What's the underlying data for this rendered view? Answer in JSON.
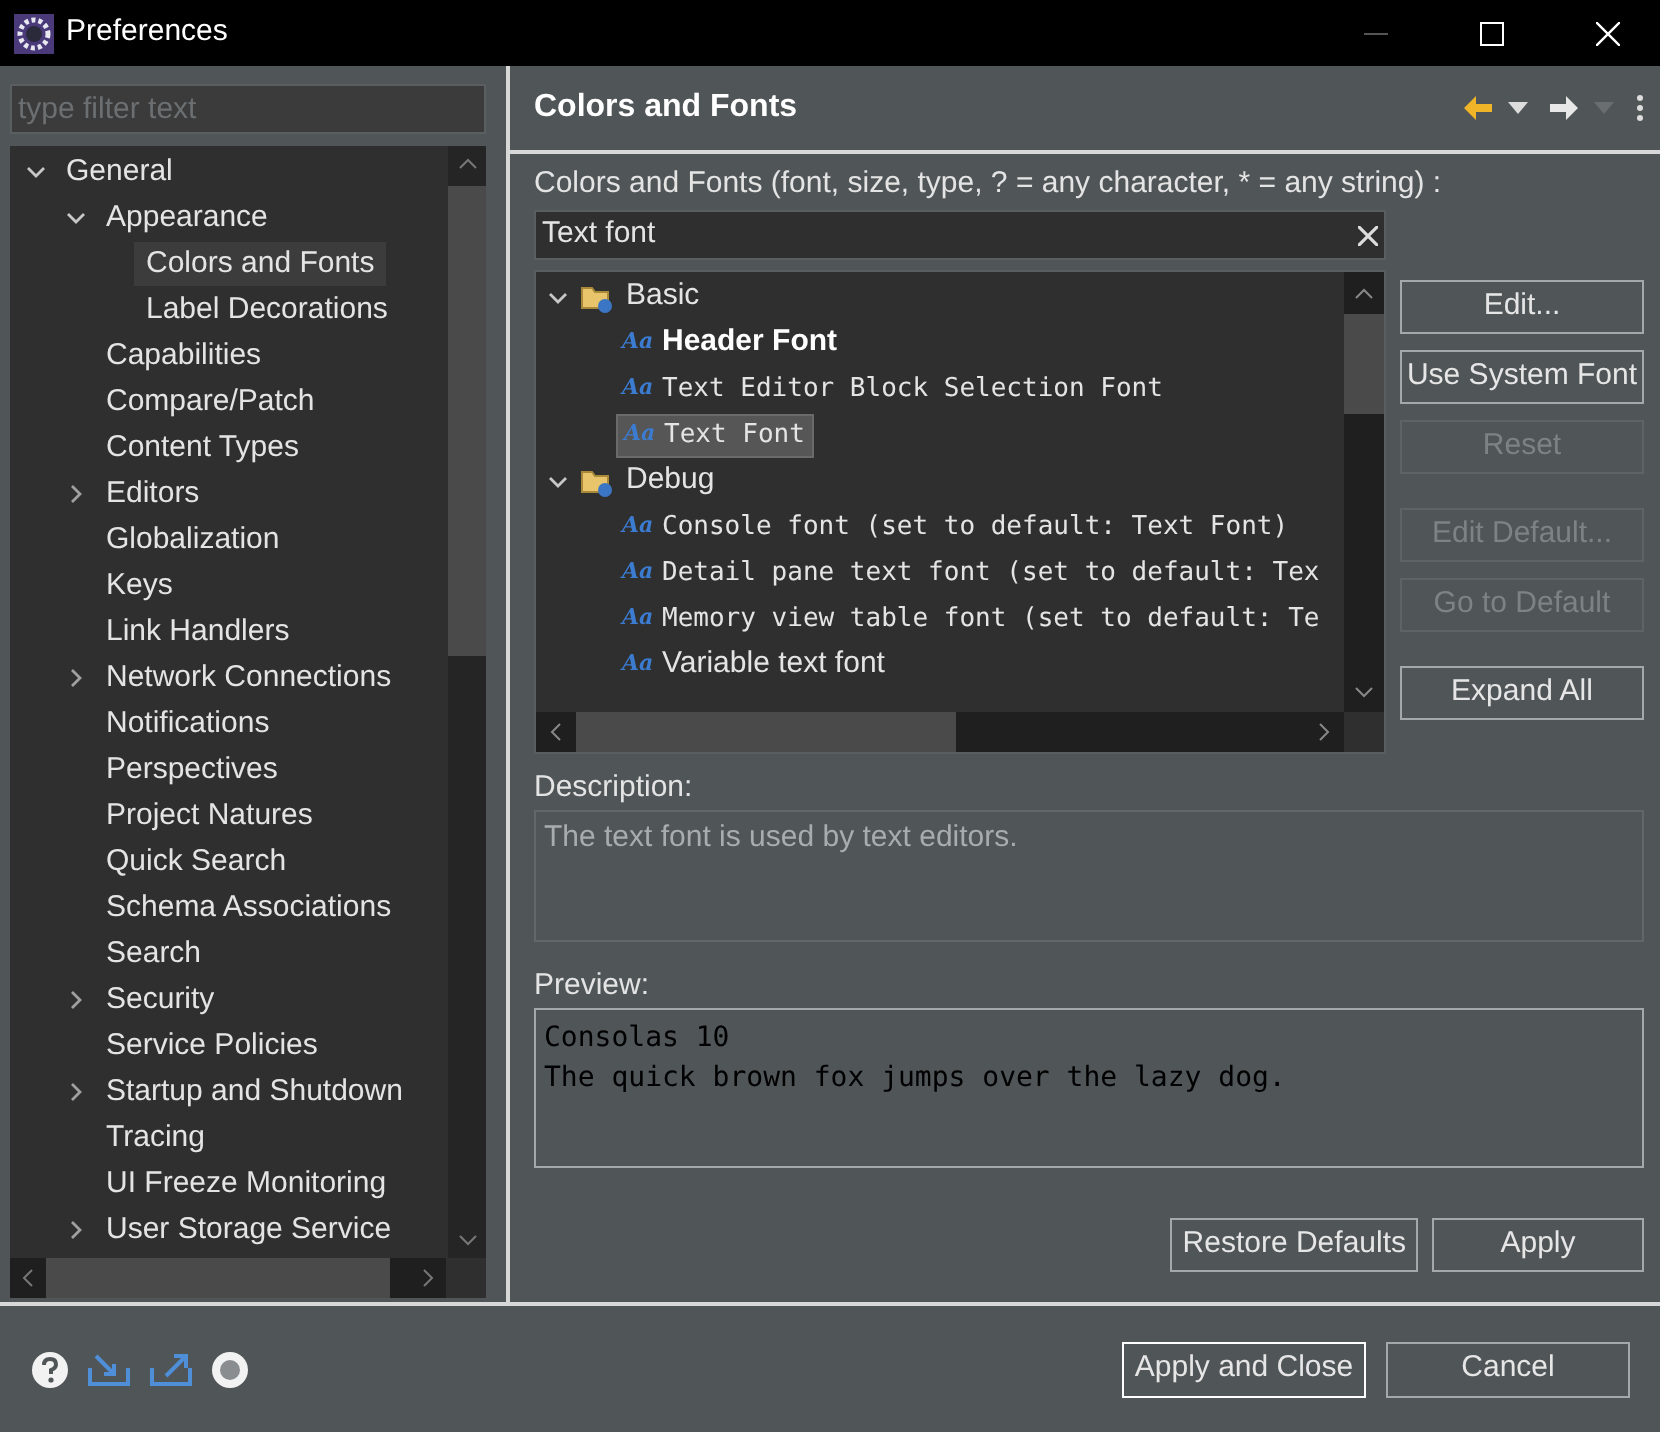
{
  "window": {
    "title": "Preferences"
  },
  "filter": {
    "placeholder": "type filter text"
  },
  "nav_tree": [
    {
      "label": "General",
      "expanded": true,
      "selected": false,
      "children": [
        {
          "label": "Appearance",
          "expanded": true,
          "selected": false,
          "children": [
            {
              "label": "Colors and Fonts",
              "selected": true
            },
            {
              "label": "Label Decorations",
              "selected": false
            }
          ]
        },
        {
          "label": "Capabilities",
          "selected": false
        },
        {
          "label": "Compare/Patch",
          "selected": false
        },
        {
          "label": "Content Types",
          "selected": false
        },
        {
          "label": "Editors",
          "expanded": false,
          "selected": false
        },
        {
          "label": "Globalization",
          "selected": false
        },
        {
          "label": "Keys",
          "selected": false
        },
        {
          "label": "Link Handlers",
          "selected": false
        },
        {
          "label": "Network Connections",
          "expanded": false,
          "selected": false
        },
        {
          "label": "Notifications",
          "selected": false
        },
        {
          "label": "Perspectives",
          "selected": false
        },
        {
          "label": "Project Natures",
          "selected": false
        },
        {
          "label": "Quick Search",
          "selected": false
        },
        {
          "label": "Schema Associations",
          "selected": false
        },
        {
          "label": "Search",
          "selected": false
        },
        {
          "label": "Security",
          "expanded": false,
          "selected": false
        },
        {
          "label": "Service Policies",
          "selected": false
        },
        {
          "label": "Startup and Shutdown",
          "expanded": false,
          "selected": false
        },
        {
          "label": "Tracing",
          "selected": false
        },
        {
          "label": "UI Freeze Monitoring",
          "selected": false
        },
        {
          "label": "User Storage Service",
          "expanded": false,
          "selected": false
        }
      ]
    }
  ],
  "page": {
    "title": "Colors and Fonts",
    "filter_label": "Colors and Fonts (font, size, type, ? = any character, * = any string) :",
    "filter_value": "Text font",
    "font_tree": [
      {
        "kind": "category",
        "label": "Basic",
        "expanded": true
      },
      {
        "kind": "font",
        "icon": "Aa",
        "label": "Header Font",
        "bold": true,
        "selected": false
      },
      {
        "kind": "font",
        "icon": "Aa",
        "label": "Text Editor Block Selection Font",
        "bold": false,
        "selected": false
      },
      {
        "kind": "font",
        "icon": "Aa",
        "label": "Text Font",
        "bold": false,
        "selected": true
      },
      {
        "kind": "category",
        "label": "Debug",
        "expanded": true
      },
      {
        "kind": "font",
        "icon": "Aa",
        "label": "Console font (set to default: Text Font)",
        "bold": false,
        "selected": false
      },
      {
        "kind": "font",
        "icon": "Aa",
        "label": "Detail pane text font (set to default: Tex",
        "bold": false,
        "selected": false
      },
      {
        "kind": "font",
        "icon": "Aa",
        "label": "Memory view table font (set to default: Te",
        "bold": false,
        "selected": false
      },
      {
        "kind": "sans_font",
        "icon": "Aa",
        "label": "Variable text font",
        "bold": false,
        "selected": false
      }
    ],
    "side_buttons": [
      {
        "label": "Edit...",
        "disabled": false
      },
      {
        "label": "Use System Font",
        "disabled": false
      },
      {
        "label": "Reset",
        "disabled": true
      },
      {
        "label": "Edit Default...",
        "disabled": true
      },
      {
        "label": "Go to Default",
        "disabled": true
      },
      {
        "label": "Expand All",
        "disabled": false
      }
    ],
    "description_label": "Description:",
    "description": "The text font is used by text editors.",
    "preview_label": "Preview:",
    "preview_lines": [
      "Consolas 10",
      "The quick brown fox jumps over the lazy dog."
    ],
    "buttons": [
      "Restore Defaults",
      "Apply"
    ]
  },
  "footer_buttons": [
    "Apply and Close",
    "Cancel"
  ]
}
